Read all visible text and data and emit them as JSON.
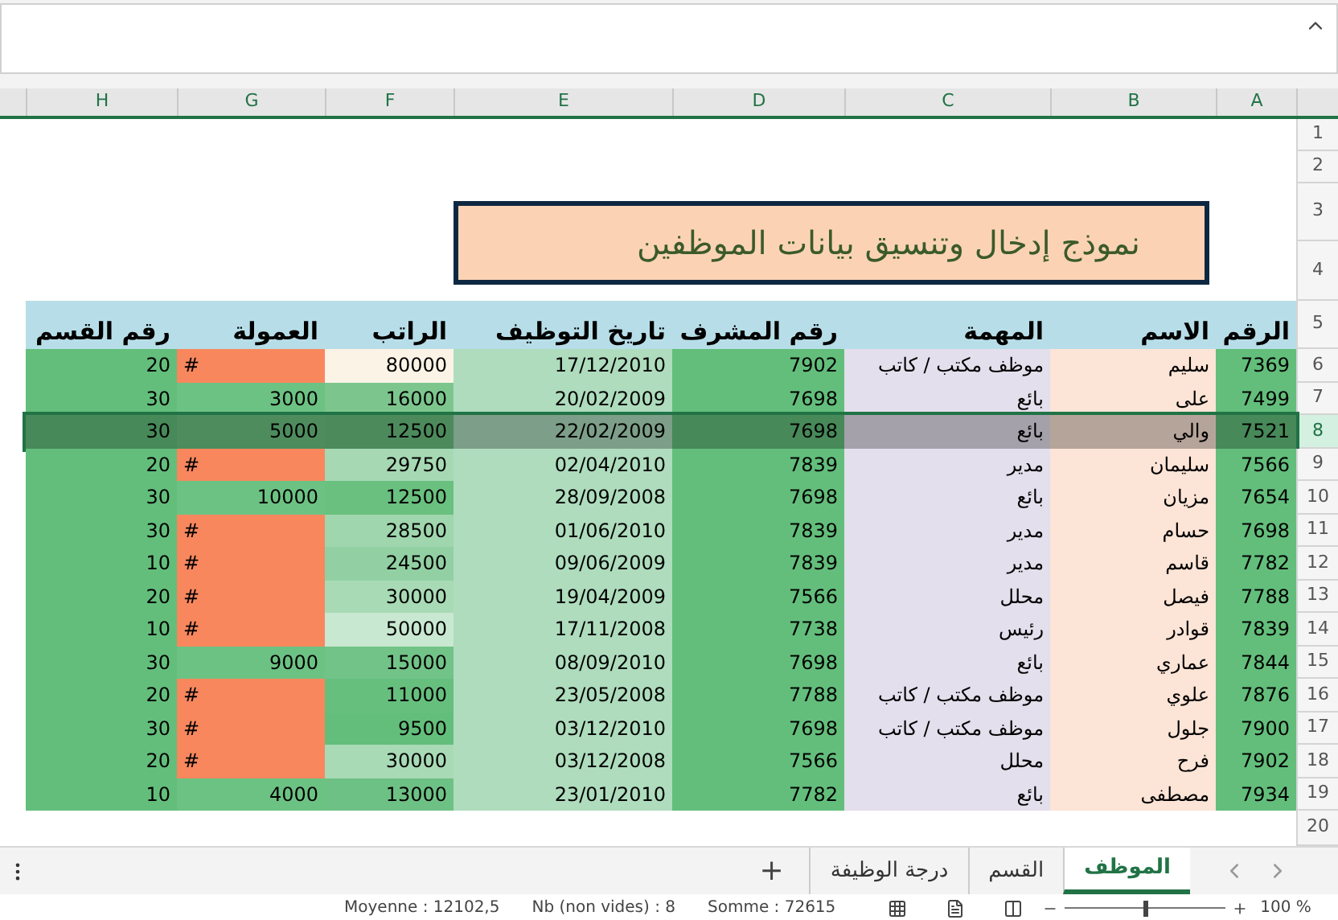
{
  "column_letters": [
    "A",
    "B",
    "C",
    "D",
    "E",
    "F",
    "G",
    "H"
  ],
  "row_numbers": [
    "1",
    "2",
    "3",
    "4",
    "5",
    "6",
    "7",
    "8",
    "9",
    "10",
    "11",
    "12",
    "13",
    "14",
    "15",
    "16",
    "17",
    "18",
    "19",
    "20"
  ],
  "title": "نموذج إدخال وتنسيق بيانات الموظفين",
  "headers": [
    "الرقم",
    "الاسم",
    "المهمة",
    "رقم المشرف",
    "تاريخ التوظيف",
    "الراتب",
    "العمولة",
    "رقم القسم"
  ],
  "rows": [
    {
      "id": "7369",
      "name": "سليم",
      "job": "موظف مكتب / كاتب",
      "manager": "7902",
      "hire_date": "17/12/2010",
      "salary": "80000",
      "color": "#fbf3e6",
      "commission": "#",
      "commission_error": true,
      "dept": "20",
      "selected": false
    },
    {
      "id": "7499",
      "name": "على",
      "job": "بائع",
      "manager": "7698",
      "hire_date": "20/02/2009",
      "salary": "16000",
      "color": "#7cc68e",
      "commission": "3000",
      "commission_error": false,
      "dept": "30",
      "selected": false
    },
    {
      "id": "7521",
      "name": "والي",
      "job": "بائع",
      "manager": "7698",
      "hire_date": "22/02/2009",
      "salary": "12500",
      "color": "#4c8a5c",
      "commission": "5000",
      "commission_error": false,
      "dept": "30",
      "selected": true
    },
    {
      "id": "7566",
      "name": "سليمان",
      "job": "مدير",
      "manager": "7839",
      "hire_date": "02/04/2010",
      "salary": "29750",
      "color": "#a6d9b3",
      "commission": "#",
      "commission_error": true,
      "dept": "20",
      "selected": false
    },
    {
      "id": "7654",
      "name": "مزيان",
      "job": "بائع",
      "manager": "7698",
      "hire_date": "28/09/2008",
      "salary": "12500",
      "color": "#6ac07f",
      "commission": "10000",
      "commission_error": false,
      "dept": "30",
      "selected": false
    },
    {
      "id": "7698",
      "name": "حسام",
      "job": "مدير",
      "manager": "7839",
      "hire_date": "01/06/2010",
      "salary": "28500",
      "color": "#9fd6ad",
      "commission": "#",
      "commission_error": true,
      "dept": "30",
      "selected": false
    },
    {
      "id": "7782",
      "name": "قاسم",
      "job": "مدير",
      "manager": "7839",
      "hire_date": "09/06/2009",
      "salary": "24500",
      "color": "#92d0a3",
      "commission": "#",
      "commission_error": true,
      "dept": "10",
      "selected": false
    },
    {
      "id": "7788",
      "name": "فيصل",
      "job": "محلل",
      "manager": "7566",
      "hire_date": "19/04/2009",
      "salary": "30000",
      "color": "#a8dab5",
      "commission": "#",
      "commission_error": true,
      "dept": "20",
      "selected": false
    },
    {
      "id": "7839",
      "name": "قوادر",
      "job": "رئيس",
      "manager": "7738",
      "hire_date": "17/11/2008",
      "salary": "50000",
      "color": "#c9e8d1",
      "commission": "#",
      "commission_error": true,
      "dept": "10",
      "selected": false
    },
    {
      "id": "7844",
      "name": "عماري",
      "job": "بائع",
      "manager": "7698",
      "hire_date": "08/09/2010",
      "salary": "15000",
      "color": "#72c387",
      "commission": "9000",
      "commission_error": false,
      "dept": "30",
      "selected": false
    },
    {
      "id": "7876",
      "name": "علوي",
      "job": "موظف مكتب / كاتب",
      "manager": "7788",
      "hire_date": "23/05/2008",
      "salary": "11000",
      "color": "#67bf7e",
      "commission": "#",
      "commission_error": true,
      "dept": "20",
      "selected": false
    },
    {
      "id": "7900",
      "name": "جلول",
      "job": "موظف مكتب / كاتب",
      "manager": "7698",
      "hire_date": "03/12/2010",
      "salary": "9500",
      "color": "#63be7b",
      "commission": "#",
      "commission_error": true,
      "dept": "30",
      "selected": false
    },
    {
      "id": "7902",
      "name": "فرح",
      "job": "محلل",
      "manager": "7566",
      "hire_date": "03/12/2008",
      "salary": "30000",
      "color": "#a8dab5",
      "commission": "#",
      "commission_error": true,
      "dept": "20",
      "selected": false
    },
    {
      "id": "7934",
      "name": "مصطفى",
      "job": "بائع",
      "manager": "7782",
      "hire_date": "23/01/2010",
      "salary": "13000",
      "color": "#6ec184",
      "commission": "4000",
      "commission_error": false,
      "dept": "10",
      "selected": false
    }
  ],
  "sheet_tabs": [
    {
      "label": "الموظف",
      "selected": true
    },
    {
      "label": "القسم",
      "selected": false
    },
    {
      "label": "درجة الوظيفة",
      "selected": false
    }
  ],
  "add_sheet": "+",
  "status_bar": {
    "average": "Moyenne : 12102,5",
    "count": "Nb (non vides) : 8",
    "sum": "Somme : 72615",
    "zoom": "100 %",
    "level": 0.5
  }
}
